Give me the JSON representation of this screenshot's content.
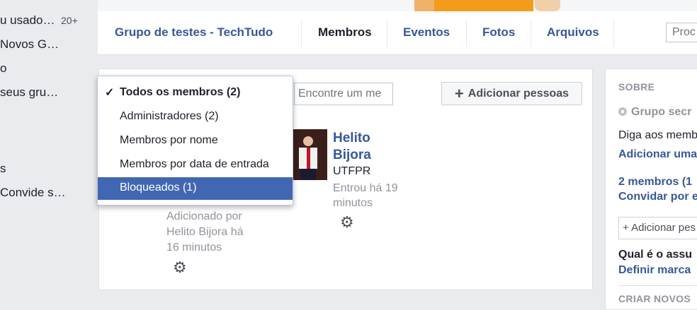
{
  "sidebar": {
    "items": [
      {
        "label": "u usado…",
        "count": "20+"
      },
      {
        "label": "Novos G…"
      },
      {
        "label": "o"
      },
      {
        "label": "seus gru…"
      },
      {
        "label": "s"
      },
      {
        "label": "Convide s…"
      }
    ]
  },
  "nav": {
    "group_name": "Grupo de testes - TechTudo",
    "tabs": [
      "Membros",
      "Eventos",
      "Fotos",
      "Arquivos"
    ],
    "search_placeholder": "Proc"
  },
  "members": {
    "find_placeholder": "Encontre um me",
    "add_button": "Adicionar pessoas",
    "left_member_info": [
      "Adicionado por",
      "Helito Bijora há",
      "16 minutos"
    ],
    "member": {
      "name_line1": "Helito",
      "name_line2": "Bijora",
      "school": "UTFPR",
      "joined_line1": "Entrou há 19",
      "joined_line2": "minutos"
    }
  },
  "filter_dropdown": {
    "selected_index": 4,
    "checked_index": 0,
    "items": [
      "Todos os membros (2)",
      "Administradores (2)",
      "Membros por nome",
      "Membros por data de entrada",
      "Bloqueados (1)"
    ]
  },
  "about": {
    "heading": "SOBRE",
    "privacy": "Grupo secr",
    "tell_text": "Diga aos memb",
    "add_link": "Adicionar uma",
    "members_count": "2 membros  (1",
    "invite_link": "Convidar por e",
    "add_people_placeholder": "+ Adicionar pes",
    "question": "Qual é o assu",
    "tags_link": "Definir marca",
    "create_heading": "CRIAR NOVOS"
  },
  "colors": {
    "link": "#365899",
    "selected": "#4267b2",
    "muted": "#90949c"
  }
}
